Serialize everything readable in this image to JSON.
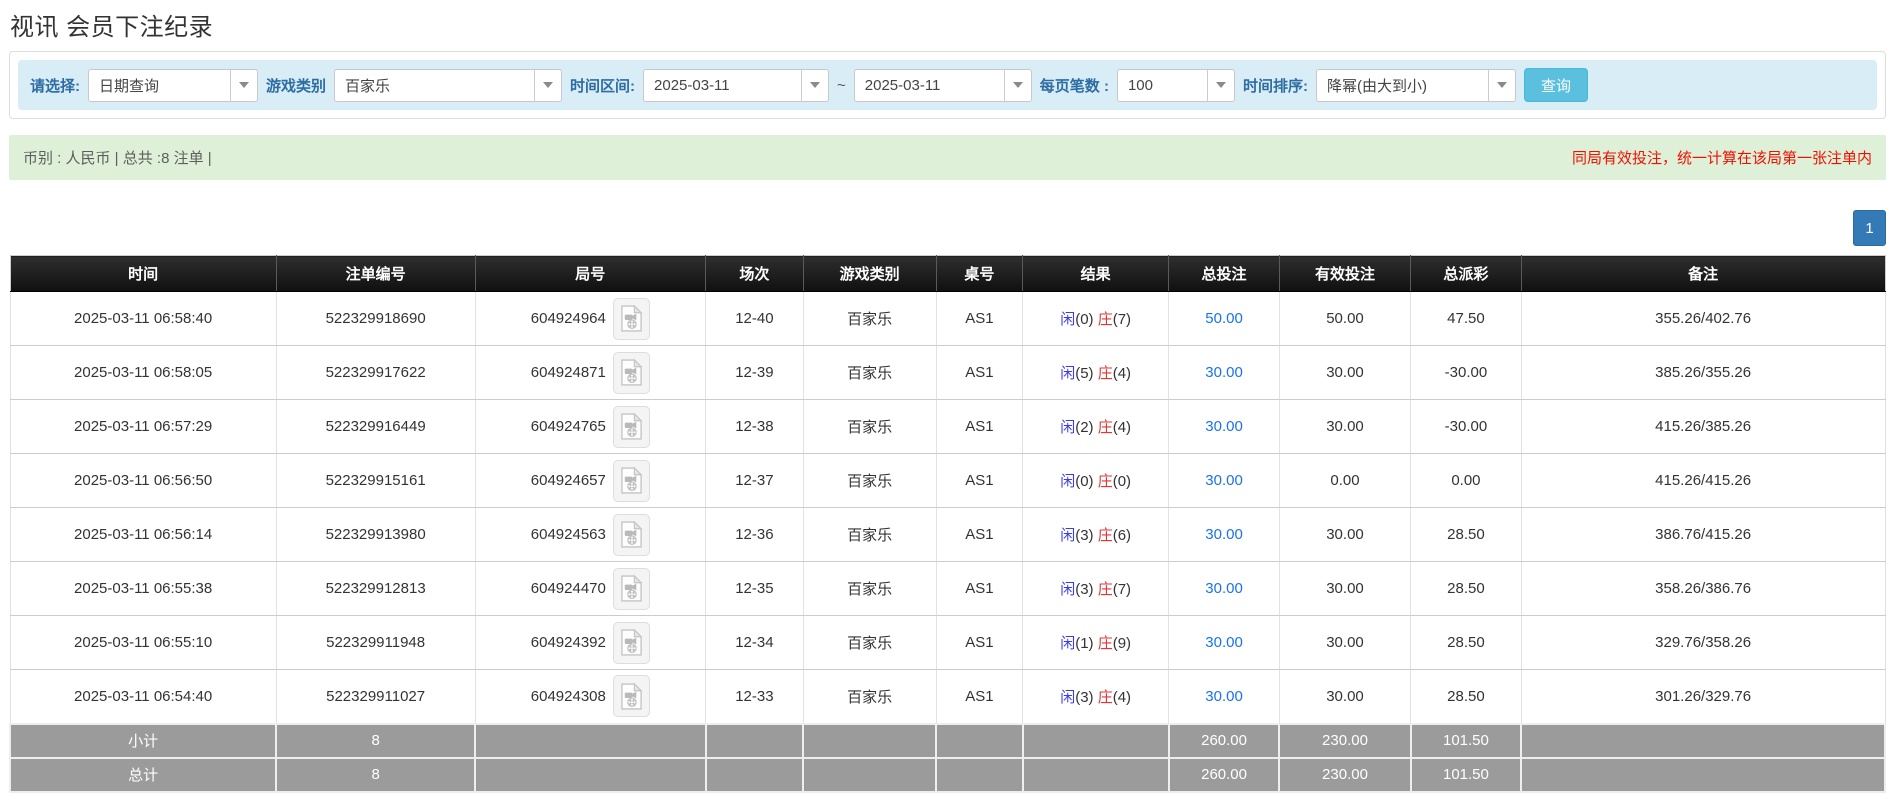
{
  "page": {
    "title": "视讯 会员下注纪录"
  },
  "filters": {
    "select_label": "请选择:",
    "select_value": "日期查询",
    "game_type_label": "游戏类别",
    "game_type_value": "百家乐",
    "time_range_label": "时间区间:",
    "date_from": "2025-03-11",
    "tilde": "~",
    "date_to": "2025-03-11",
    "page_size_label": "每页笔数 :",
    "page_size_value": "100",
    "sort_label": "时间排序:",
    "sort_value": "降幂(由大到小)",
    "search_button": "查询"
  },
  "summary": {
    "left": "币别 : 人民币 | 总共 :8 注单 |",
    "right_notice": "同局有效投注，统一计算在该局第一张注单内"
  },
  "pagination": {
    "current": "1"
  },
  "table": {
    "headers": [
      "时间",
      "注单编号",
      "局号",
      "场次",
      "游戏类别",
      "桌号",
      "结果",
      "总投注",
      "有效投注",
      "总派彩",
      "备注"
    ],
    "video_icon": "video-file-icon",
    "rows": [
      {
        "time": "2025-03-11 06:58:40",
        "bet_id": "522329918690",
        "round_id": "604924964",
        "session": "12-40",
        "game": "百家乐",
        "table_no": "AS1",
        "result": {
          "p_label": "闲",
          "p_count": "(0)",
          "b_label": "庄",
          "b_count": "(7)"
        },
        "total_bet": "50.00",
        "valid_bet": "50.00",
        "payout": "47.50",
        "remark": "355.26/402.76"
      },
      {
        "time": "2025-03-11 06:58:05",
        "bet_id": "522329917622",
        "round_id": "604924871",
        "session": "12-39",
        "game": "百家乐",
        "table_no": "AS1",
        "result": {
          "p_label": "闲",
          "p_count": "(5)",
          "b_label": "庄",
          "b_count": "(4)"
        },
        "total_bet": "30.00",
        "valid_bet": "30.00",
        "payout": "-30.00",
        "remark": "385.26/355.26"
      },
      {
        "time": "2025-03-11 06:57:29",
        "bet_id": "522329916449",
        "round_id": "604924765",
        "session": "12-38",
        "game": "百家乐",
        "table_no": "AS1",
        "result": {
          "p_label": "闲",
          "p_count": "(2)",
          "b_label": "庄",
          "b_count": "(4)"
        },
        "total_bet": "30.00",
        "valid_bet": "30.00",
        "payout": "-30.00",
        "remark": "415.26/385.26"
      },
      {
        "time": "2025-03-11 06:56:50",
        "bet_id": "522329915161",
        "round_id": "604924657",
        "session": "12-37",
        "game": "百家乐",
        "table_no": "AS1",
        "result": {
          "p_label": "闲",
          "p_count": "(0)",
          "b_label": "庄",
          "b_count": "(0)"
        },
        "total_bet": "30.00",
        "valid_bet": "0.00",
        "payout": "0.00",
        "remark": "415.26/415.26"
      },
      {
        "time": "2025-03-11 06:56:14",
        "bet_id": "522329913980",
        "round_id": "604924563",
        "session": "12-36",
        "game": "百家乐",
        "table_no": "AS1",
        "result": {
          "p_label": "闲",
          "p_count": "(3)",
          "b_label": "庄",
          "b_count": "(6)"
        },
        "total_bet": "30.00",
        "valid_bet": "30.00",
        "payout": "28.50",
        "remark": "386.76/415.26"
      },
      {
        "time": "2025-03-11 06:55:38",
        "bet_id": "522329912813",
        "round_id": "604924470",
        "session": "12-35",
        "game": "百家乐",
        "table_no": "AS1",
        "result": {
          "p_label": "闲",
          "p_count": "(3)",
          "b_label": "庄",
          "b_count": "(7)"
        },
        "total_bet": "30.00",
        "valid_bet": "30.00",
        "payout": "28.50",
        "remark": "358.26/386.76"
      },
      {
        "time": "2025-03-11 06:55:10",
        "bet_id": "522329911948",
        "round_id": "604924392",
        "session": "12-34",
        "game": "百家乐",
        "table_no": "AS1",
        "result": {
          "p_label": "闲",
          "p_count": "(1)",
          "b_label": "庄",
          "b_count": "(9)"
        },
        "total_bet": "30.00",
        "valid_bet": "30.00",
        "payout": "28.50",
        "remark": "329.76/358.26"
      },
      {
        "time": "2025-03-11 06:54:40",
        "bet_id": "522329911027",
        "round_id": "604924308",
        "session": "12-33",
        "game": "百家乐",
        "table_no": "AS1",
        "result": {
          "p_label": "闲",
          "p_count": "(3)",
          "b_label": "庄",
          "b_count": "(4)"
        },
        "total_bet": "30.00",
        "valid_bet": "30.00",
        "payout": "28.50",
        "remark": "301.26/329.76"
      }
    ],
    "footer": [
      {
        "label": "小计",
        "count": "8",
        "total_bet": "260.00",
        "valid_bet": "230.00",
        "payout": "101.50"
      },
      {
        "label": "总计",
        "count": "8",
        "total_bet": "260.00",
        "valid_bet": "230.00",
        "payout": "101.50"
      }
    ]
  },
  "colors": {
    "filter_bar_bg": "#d9edf7",
    "label_blue": "#2d6da3",
    "search_btn_bg": "#5bc0de",
    "summary_bg": "#dff0d8",
    "notice_red": "#ee1100",
    "pagination_bg": "#337ab7",
    "header_bg": "#1a1a1a",
    "player_blue": "#3b3bf0",
    "banker_red": "#e63333",
    "amount_link_blue": "#1a73e8",
    "negative_red": "#ee1111",
    "footer_grey": "#9b9b9b"
  }
}
